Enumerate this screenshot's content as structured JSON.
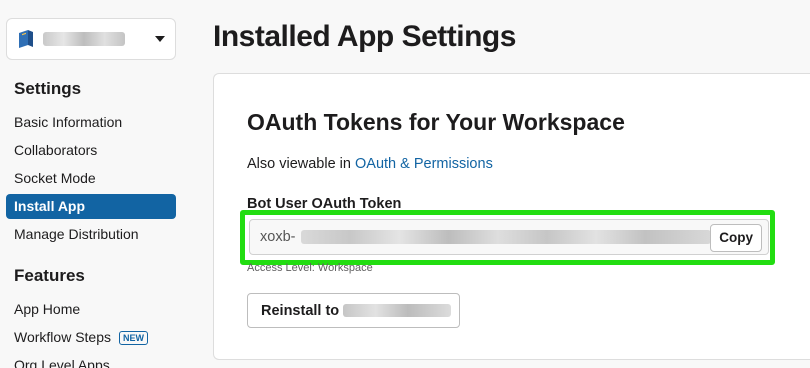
{
  "sidebar": {
    "app_select": {
      "icon": "book-icon",
      "name": "[redacted]"
    },
    "settings_heading": "Settings",
    "settings_items": [
      {
        "label": "Basic Information",
        "active": false
      },
      {
        "label": "Collaborators",
        "active": false
      },
      {
        "label": "Socket Mode",
        "active": false
      },
      {
        "label": "Install App",
        "active": true
      },
      {
        "label": "Manage Distribution",
        "active": false
      }
    ],
    "features_heading": "Features",
    "features_items": [
      {
        "label": "App Home"
      },
      {
        "label": "Workflow Steps",
        "badge": "NEW"
      },
      {
        "label": "Org Level Apps"
      }
    ]
  },
  "main": {
    "title": "Installed App Settings",
    "card": {
      "title": "OAuth Tokens for Your Workspace",
      "also_prefix": "Also viewable in",
      "also_link": "OAuth & Permissions",
      "token_label": "Bot User OAuth Token",
      "token_prefix": "xoxb-",
      "copy_label": "Copy",
      "access_level": "Access Level: Workspace",
      "reinstall_label": "Reinstall to"
    }
  },
  "colors": {
    "accent": "#1264a3",
    "highlight": "#22dd11"
  }
}
